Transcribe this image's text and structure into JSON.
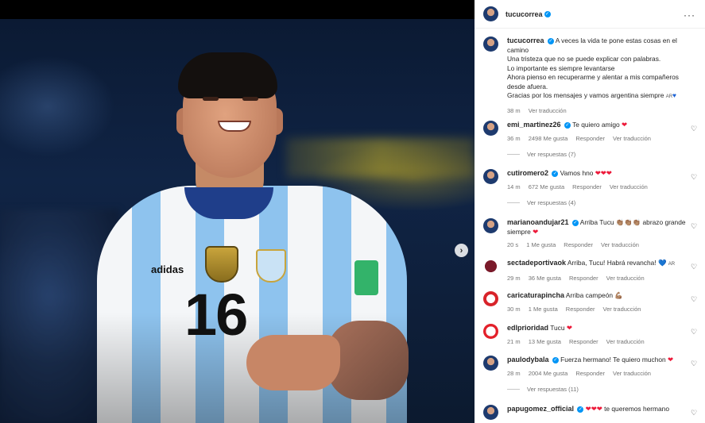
{
  "media": {
    "jersey_number": "16",
    "brand": "adidas",
    "next_glyph": "›"
  },
  "post": {
    "author": "tucucorrea",
    "more_glyph": "···",
    "caption": {
      "author": "tucucorrea",
      "lines": [
        "A veces la vida te pone estas cosas en el camino",
        "Una tristeza que no se puede explicar con palabras.",
        "Lo importante es siempre levantarse",
        "Ahora pienso en recuperarme y alentar a mis compañeros desde afuera.",
        "Gracias por los mensajes y vamos argentina siempre"
      ],
      "flag_tag": "AR",
      "time": "38 m",
      "translate": "Ver traducción"
    }
  },
  "comments": [
    {
      "user": "emi_martinez26",
      "verified": true,
      "text": "Te quiero amigo",
      "emoji": "❤",
      "time": "36 m",
      "likes": "2498 Me gusta",
      "reply": "Responder",
      "translate": "Ver traducción",
      "replies": "Ver respuestas (7)"
    },
    {
      "user": "cutiromero2",
      "verified": true,
      "text": "Vamos hno",
      "emoji": "❤❤❤",
      "time": "14 m",
      "likes": "672 Me gusta",
      "reply": "Responder",
      "translate": "Ver traducción",
      "replies": "Ver respuestas (4)"
    },
    {
      "user": "marianoandujar21",
      "verified": true,
      "text": "Arriba Tucu",
      "emoji_mid": "👏🏽👏🏽👏🏽",
      "text2": "abrazo grande siempre",
      "emoji": "❤",
      "time": "20 s",
      "likes": "1 Me gusta",
      "reply": "Responder",
      "translate": "Ver traducción"
    },
    {
      "user": "sectadeportivaok",
      "verified": false,
      "text": "Arriba, Tucu! Habrá revancha!",
      "emoji": "💙",
      "tag": "AR",
      "time": "29 m",
      "likes": "36 Me gusta",
      "reply": "Responder",
      "translate": "Ver traducción"
    },
    {
      "user": "caricaturapincha",
      "verified": false,
      "text": "Arriba campeón",
      "emoji": "💪🏽",
      "time": "30 m",
      "likes": "1 Me gusta",
      "reply": "Responder",
      "translate": "Ver traducción"
    },
    {
      "user": "edlprioridad",
      "verified": false,
      "text": "Tucu",
      "emoji": "❤",
      "time": "21 m",
      "likes": "13 Me gusta",
      "reply": "Responder",
      "translate": "Ver traducción"
    },
    {
      "user": "paulodybala",
      "verified": true,
      "text": "Fuerza hermano! Te quiero muchon",
      "emoji": "❤",
      "time": "28 m",
      "likes": "2004 Me gusta",
      "reply": "Responder",
      "translate": "Ver traducción",
      "replies": "Ver respuestas (11)"
    },
    {
      "user": "papugomez_official",
      "verified": true,
      "text": "te queremos hermano",
      "emoji": "❤❤❤",
      "time": "",
      "likes": "",
      "reply": "",
      "translate": ""
    }
  ],
  "icons": {
    "like": "heart-outline-icon",
    "verified": "verified-badge-icon",
    "more": "more-options-icon",
    "next": "chevron-right-icon"
  },
  "colors": {
    "verified_blue": "#0095f6",
    "heart_red": "#ed1a3a",
    "meta_gray": "#737373"
  }
}
